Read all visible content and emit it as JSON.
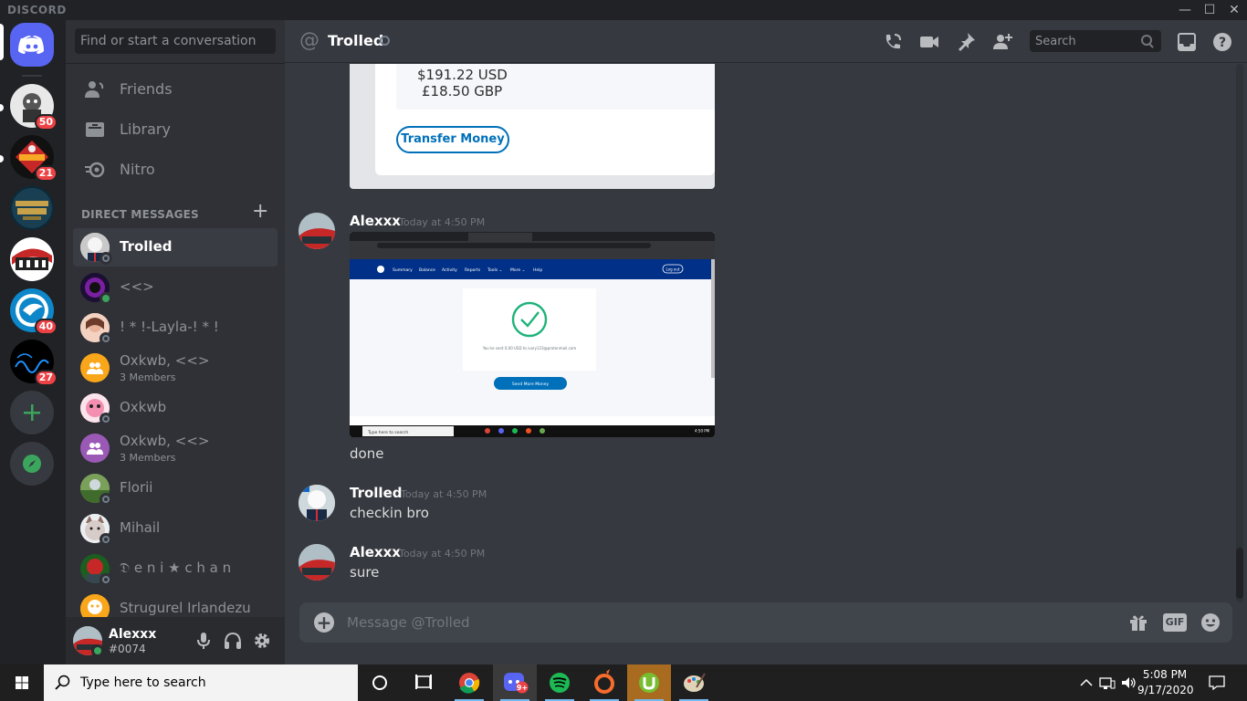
{
  "titlebar": {
    "brand": "DISCORD",
    "minimize": "—",
    "maximize": "☐",
    "close": "✕"
  },
  "servers": [
    {
      "name": "server-1",
      "badge": "50"
    },
    {
      "name": "server-2",
      "badge": "21"
    },
    {
      "name": "league-of-legends",
      "badge": ""
    },
    {
      "name": "alx",
      "badge": ""
    },
    {
      "name": "server-5",
      "badge": "40"
    },
    {
      "name": "server-6",
      "badge": "27"
    }
  ],
  "sidebar": {
    "search_placeholder": "Find or start a conversation",
    "nav": [
      {
        "label": "Friends",
        "icon": "friends-icon"
      },
      {
        "label": "Library",
        "icon": "library-icon"
      },
      {
        "label": "Nitro",
        "icon": "nitro-icon"
      }
    ],
    "dm_header": "DIRECT MESSAGES",
    "dm_add": "+",
    "dms": [
      {
        "name": "Trolled",
        "sub": "",
        "status": "offline",
        "active": true
      },
      {
        "name": "<<>",
        "sub": "",
        "status": "online"
      },
      {
        "name": "! * !-Layla-! * !",
        "sub": "",
        "status": "offline"
      },
      {
        "name": "Oxkwb, <<>",
        "sub": "3 Members",
        "status": "group"
      },
      {
        "name": "Oxkwb",
        "sub": "",
        "status": "offline"
      },
      {
        "name": "Oxkwb, <<>",
        "sub": "3 Members",
        "status": "group"
      },
      {
        "name": "Florii",
        "sub": "",
        "status": "offline"
      },
      {
        "name": "Mihail",
        "sub": "",
        "status": "offline"
      },
      {
        "name": "𝔇 e n i ★ c h a n",
        "sub": "",
        "status": "offline"
      },
      {
        "name": "Strugurel Irlandezu",
        "sub": "",
        "status": "offline"
      }
    ]
  },
  "user": {
    "name": "Alexxx",
    "tag": "#0074"
  },
  "chat": {
    "at": "@",
    "title": "Trolled",
    "search_placeholder": "Search",
    "embed": {
      "amount_usd": "$191.22 USD",
      "amount_gbp": "£18.50 GBP",
      "button": "Transfer Money"
    },
    "messages": [
      {
        "author": "Alexxx",
        "time": "Today at 4:50 PM",
        "text": "done"
      },
      {
        "author": "Trolled",
        "time": "Today at 4:50 PM",
        "text": "checkin bro"
      },
      {
        "author": "Alexxx",
        "time": "Today at 4:50 PM",
        "text": "sure"
      }
    ],
    "composer_placeholder": "Message @Trolled",
    "gif_label": "GIF"
  },
  "screenshot_embed": {
    "nav": [
      "Summary",
      "Balance",
      "Activity",
      "Reports",
      "Tools ⌄",
      "More ⌄",
      "Help"
    ],
    "logout": "Log out",
    "sent_text": "You've sent 0,00 USD to ivory123@protonmail.com",
    "send_more": "Send More Money",
    "taskbar_search": "Type here to search",
    "clock": "4:50 PM"
  },
  "taskbar": {
    "search_placeholder": "Type here to search",
    "time": "5:08 PM",
    "date": "9/17/2020",
    "discord_badge": "9+"
  },
  "colors": {
    "blurple": "#5865f2",
    "online": "#3ba55d",
    "badge": "#ed4245",
    "paypal": "#0070ba"
  }
}
